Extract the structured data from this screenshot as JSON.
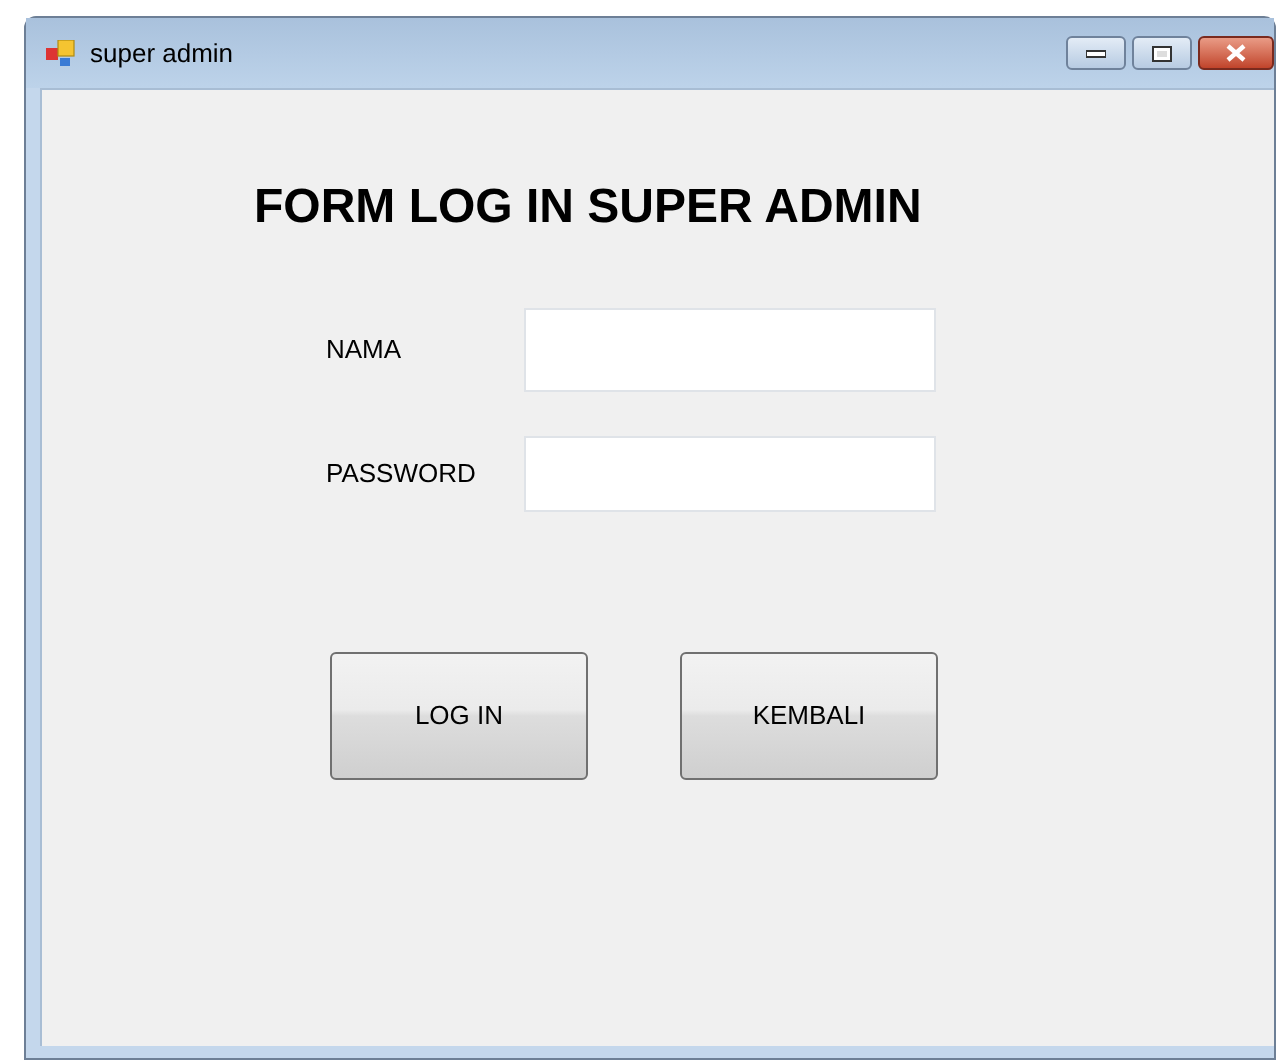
{
  "window": {
    "title": "super admin"
  },
  "heading": "FORM LOG IN SUPER ADMIN",
  "fields": [
    {
      "label": "NAMA"
    },
    {
      "label": "PASSWORD"
    }
  ],
  "buttons": [
    "LOG IN",
    "KEMBALI"
  ]
}
